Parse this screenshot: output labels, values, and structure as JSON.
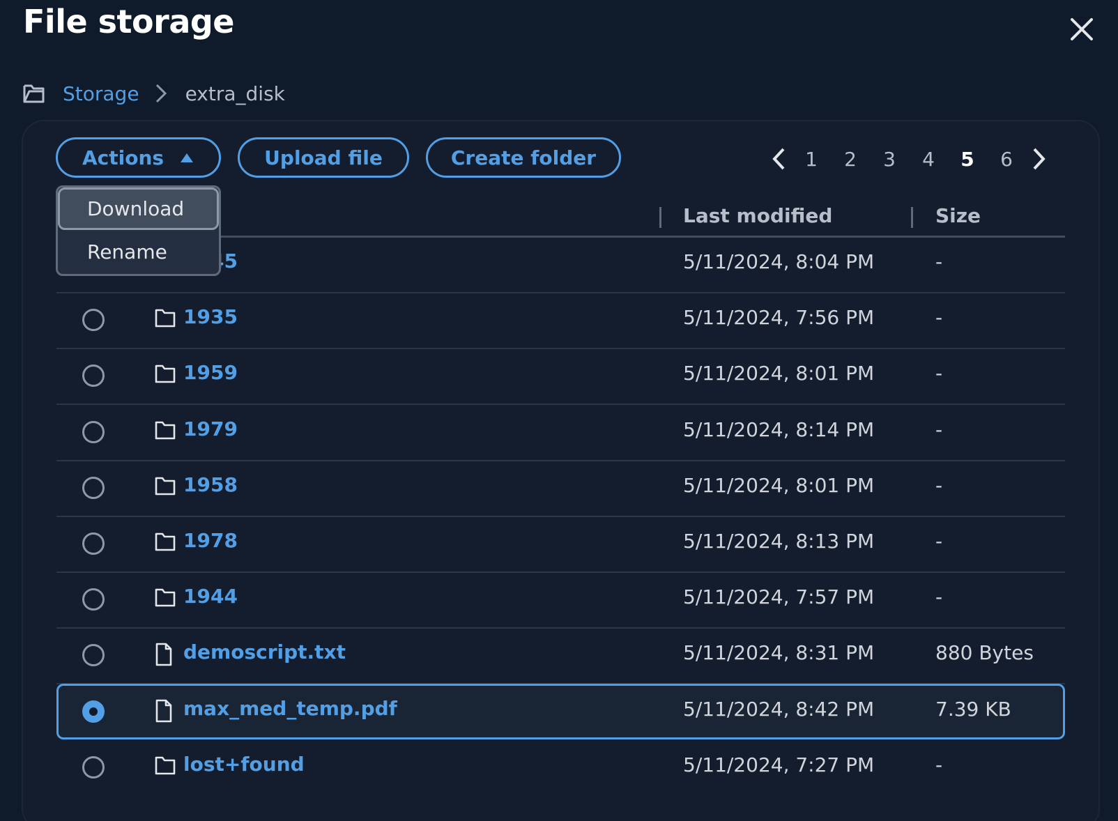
{
  "header": {
    "title": "File storage",
    "close_icon": "close-icon"
  },
  "breadcrumb": {
    "icon": "folder-open-icon",
    "root": "Storage",
    "separator_icon": "chevron-right-icon",
    "current": "extra_disk"
  },
  "toolbar": {
    "actions_label": "Actions",
    "upload_label": "Upload file",
    "create_folder_label": "Create folder"
  },
  "actions_menu": {
    "items": [
      "Download",
      "Rename"
    ],
    "highlighted": "Download"
  },
  "pagination": {
    "pages": [
      "1",
      "2",
      "3",
      "4",
      "5",
      "6"
    ],
    "current_page": "5"
  },
  "table": {
    "columns": {
      "last_modified": "Last modified",
      "size": "Size"
    },
    "rows": [
      {
        "name": "1945",
        "type": "folder",
        "modified": "5/11/2024, 8:04 PM",
        "size": "-",
        "selected": false
      },
      {
        "name": "1935",
        "type": "folder",
        "modified": "5/11/2024, 7:56 PM",
        "size": "-",
        "selected": false
      },
      {
        "name": "1959",
        "type": "folder",
        "modified": "5/11/2024, 8:01 PM",
        "size": "-",
        "selected": false
      },
      {
        "name": "1979",
        "type": "folder",
        "modified": "5/11/2024, 8:14 PM",
        "size": "-",
        "selected": false
      },
      {
        "name": "1958",
        "type": "folder",
        "modified": "5/11/2024, 8:01 PM",
        "size": "-",
        "selected": false
      },
      {
        "name": "1978",
        "type": "folder",
        "modified": "5/11/2024, 8:13 PM",
        "size": "-",
        "selected": false
      },
      {
        "name": "1944",
        "type": "folder",
        "modified": "5/11/2024, 7:57 PM",
        "size": "-",
        "selected": false
      },
      {
        "name": "demoscript.txt",
        "type": "file",
        "modified": "5/11/2024, 8:31 PM",
        "size": "880 Bytes",
        "selected": false
      },
      {
        "name": "max_med_temp.pdf",
        "type": "file",
        "modified": "5/11/2024, 8:42 PM",
        "size": "7.39 KB",
        "selected": true
      },
      {
        "name": "lost+found",
        "type": "folder",
        "modified": "5/11/2024, 7:27 PM",
        "size": "-",
        "selected": false
      }
    ]
  },
  "colors": {
    "background": "#0f1b2a",
    "panel": "#131d2d",
    "accent": "#539fe5",
    "text": "#d1d5db",
    "divider": "#414d5c"
  }
}
